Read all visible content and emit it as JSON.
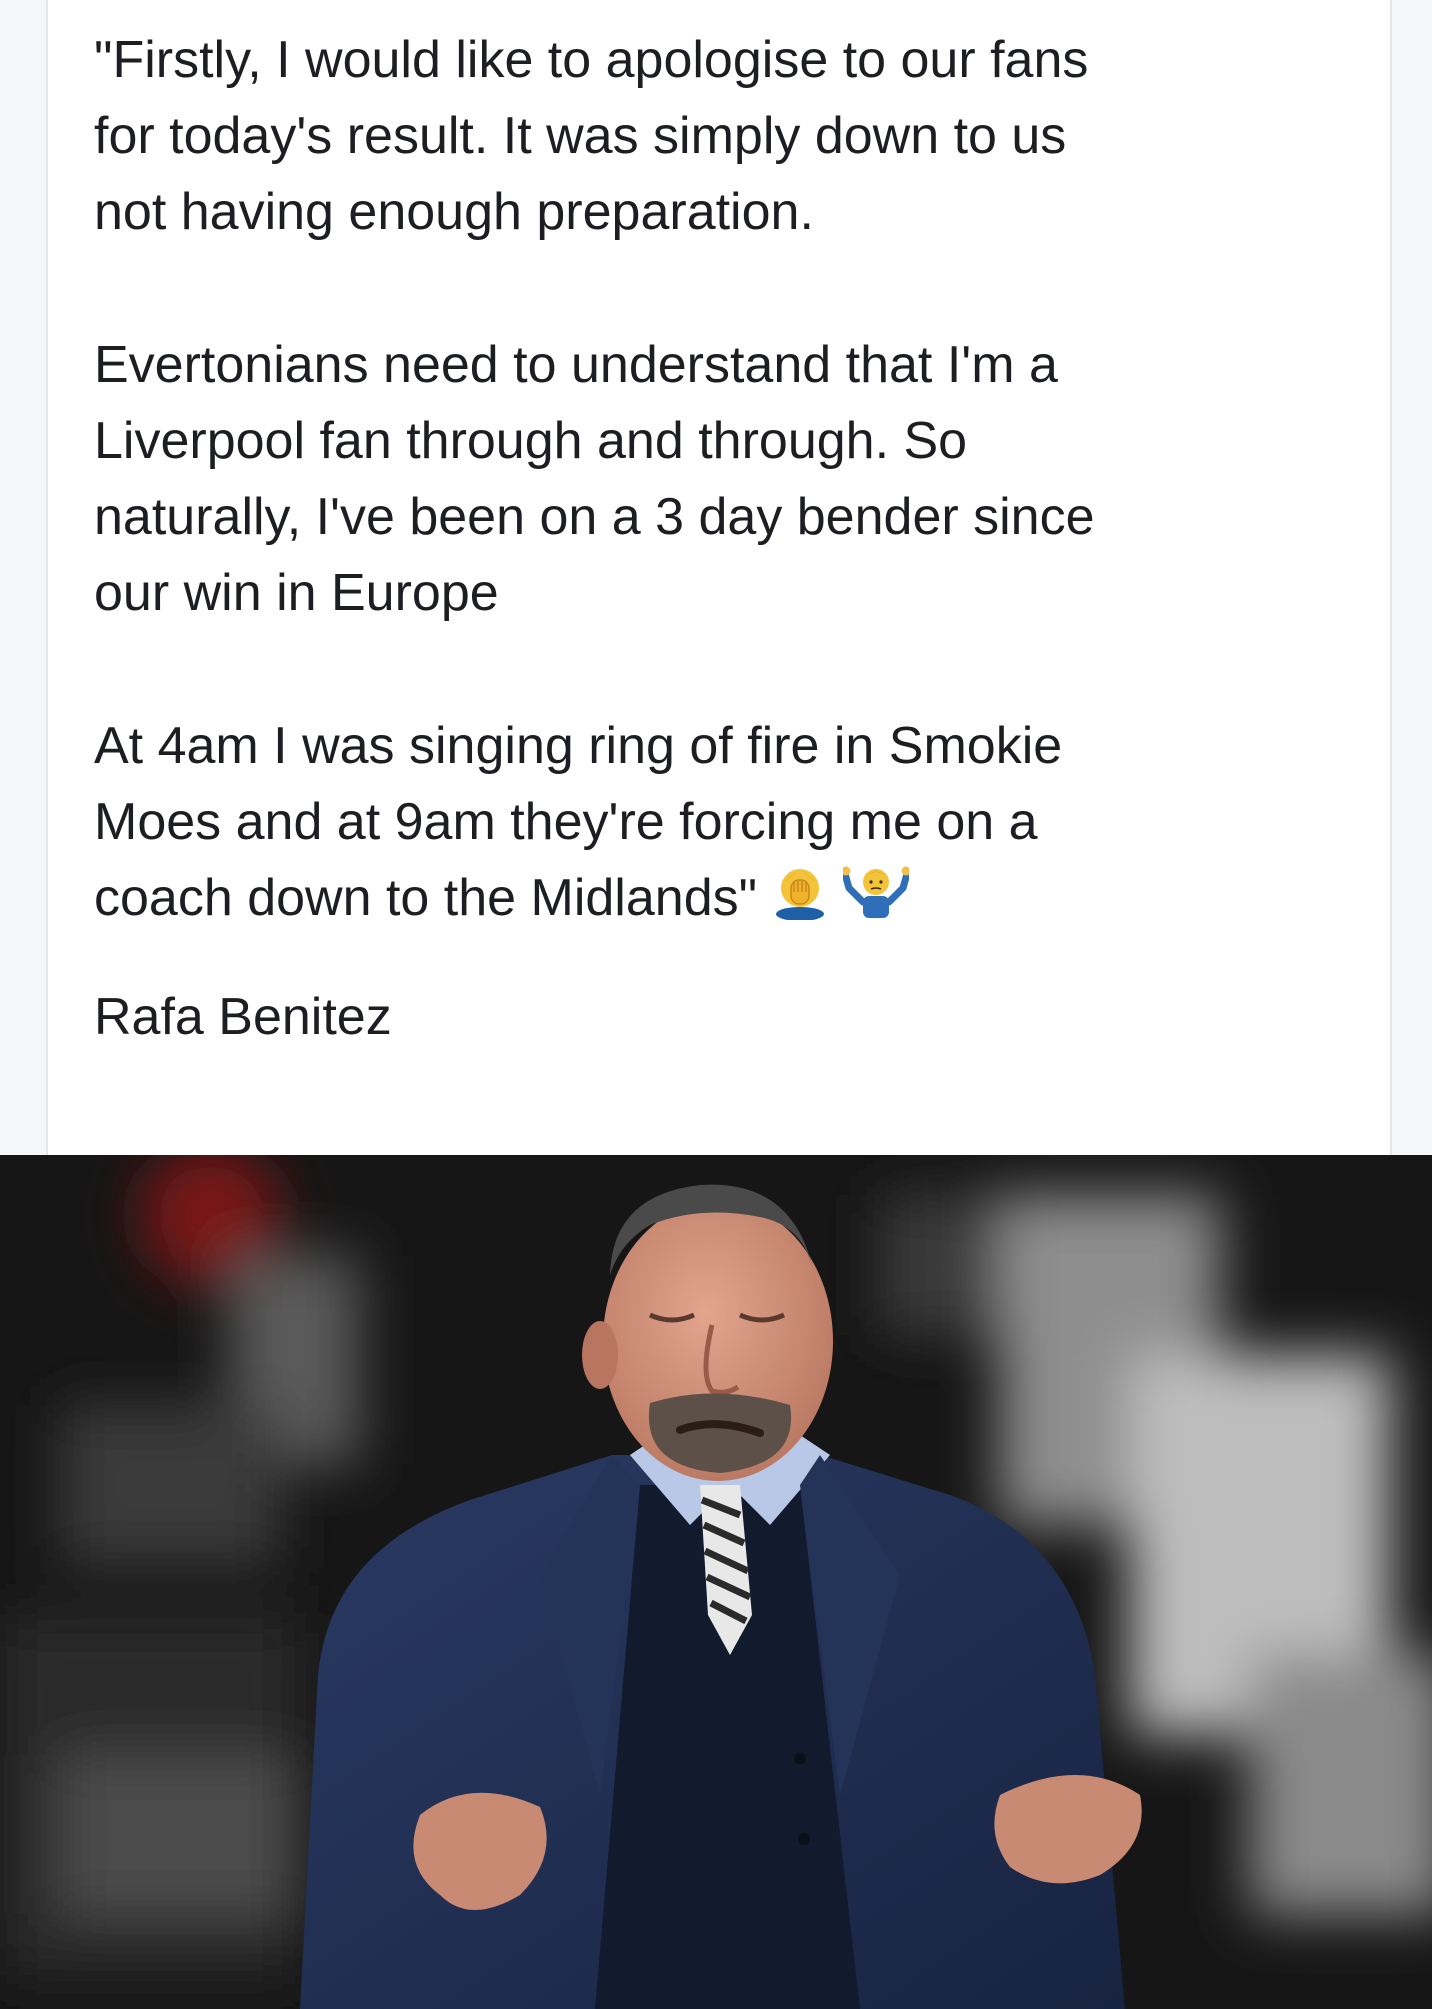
{
  "post": {
    "paragraph_1": "\"Firstly, I would like to apologise to our fans\nfor today's result. It was simply down to us\nnot having enough preparation.",
    "paragraph_2": "Evertonians need to understand that I'm a\nLiverpool fan through and through. So\nnaturally, I've been on a 3 day bender since\nour win in Europe",
    "paragraph_3": "At 4am I was singing ring of fire in Smokie\nMoes and at 9am they're forcing me on a\ncoach down to the Midlands\"",
    "signature": "Rafa Benitez",
    "emojis": [
      "facepalm-emoji",
      "shrug-emoji"
    ]
  },
  "photo": {
    "subject": "man-in-navy-coat-shrugging"
  },
  "colors": {
    "text": "#1c1e21",
    "card": "#ffffff",
    "coat": "#1f2b4a",
    "skin": "#c98a73"
  }
}
